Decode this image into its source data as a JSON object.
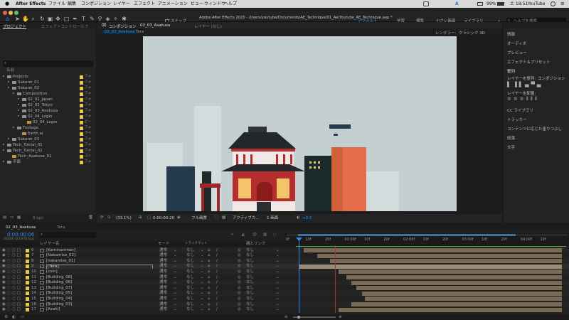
{
  "menubar": {
    "app": "After Effects",
    "items": [
      "ファイル",
      "編集",
      "コンポジション",
      "レイヤー",
      "エフェクト",
      "アニメーション",
      "ビュー",
      "ウィンドウ",
      "ヘルプ"
    ],
    "title": "Adobe After Effects 2020 - /Users/youtube/Documents/AE_Technique/01_Ae/Youtube_AE_Technique.aep *",
    "battery": "99%",
    "time": "土 18:51",
    "user": "YouTube",
    "input": "A"
  },
  "toolbar": {
    "snap_label": "スナップ",
    "workspaces": [
      "デフォルト",
      "学習",
      "標準",
      "小さい画面",
      "ライブラリ"
    ],
    "search_placeholder": "ヘルプを検索"
  },
  "project": {
    "tab": "プロジェクト",
    "tab2": "エフェクトコントロール T",
    "col_name": "名前",
    "items": [
      {
        "name": "Projects",
        "type": "フォ",
        "indent": 0,
        "folder": true
      },
      {
        "name": "Sakurei_01",
        "type": "フォ",
        "indent": 1,
        "folder": true
      },
      {
        "name": "Sakurei_02",
        "type": "フォ",
        "indent": 1,
        "folder": true
      },
      {
        "name": "Composition",
        "type": "フォ",
        "indent": 2,
        "folder": true
      },
      {
        "name": "02_01_Japan",
        "type": "フォ",
        "indent": 3,
        "folder": true
      },
      {
        "name": "02_02_Tokyo",
        "type": "フォ",
        "indent": 3,
        "folder": true
      },
      {
        "name": "02_03_Asakusa",
        "type": "フォ",
        "indent": 3,
        "folder": true
      },
      {
        "name": "02_04_Login",
        "type": "フォ",
        "indent": 3,
        "folder": true
      },
      {
        "name": "02_04_Login",
        "type": "ビー",
        "indent": 4,
        "folder": false
      },
      {
        "name": "Footage",
        "type": "フォ",
        "indent": 2,
        "folder": true
      },
      {
        "name": "Earth.ai",
        "type": "ラベ",
        "indent": 3,
        "folder": false
      },
      {
        "name": "Sakurei_03",
        "type": "フォ",
        "indent": 1,
        "folder": true
      },
      {
        "name": "Tech_Tutrial_01",
        "type": "フォ",
        "indent": 0,
        "folder": true
      },
      {
        "name": "Tech_Tutrial_02",
        "type": "フォ",
        "indent": 0,
        "folder": true
      },
      {
        "name": "Tech_Asakusa_01",
        "type": "コン",
        "indent": 1,
        "folder": false
      },
      {
        "name": "平面",
        "type": "フォ",
        "indent": 0,
        "folder": true
      }
    ],
    "bpc": "8 bpc"
  },
  "composition": {
    "panel_tab": "コンポジション",
    "comp_name": "02_03_Asakusa",
    "layer_tab": "レイヤー (なし)",
    "breadcrumb": [
      "02_03_Asakusa",
      "Tera"
    ],
    "renderer": "レンダラー:",
    "renderer_value": "クラシック 3D",
    "zoom": "(33.1%)",
    "timecode": "0:00:00:20",
    "resolution": "フル画質",
    "camera": "アクティブカ...",
    "views": "1 画面",
    "exposure": "+0.0"
  },
  "right": {
    "items": [
      "情報",
      "オーディオ",
      "プレビュー",
      "エフェクト＆プリセット",
      "整列",
      "レイヤーを整列:",
      "CC ライブラリ",
      "トラッカー",
      "コンテンツに応じた塗りつぶし",
      "段落",
      "文字"
    ],
    "align_target": "コンポジション",
    "distribute": "レイヤーを配置:"
  },
  "timeline": {
    "tabs": [
      "02_03_Asakusa",
      "Tera"
    ],
    "timecode": "0:00:00:06",
    "fps": "00006 (23.976 fps)",
    "col_layer": "レイヤー名",
    "col_mode": "モード",
    "col_trkmat": "トラックマット",
    "col_parent": "親とリンク",
    "ruler": [
      "0f",
      "10f",
      "20f",
      "01:00f",
      "10f",
      "20f",
      "02:00f",
      "10f",
      "20f",
      "03:00f",
      "10f",
      "20f",
      "04:00f",
      "10f"
    ],
    "layers": [
      {
        "num": "6",
        "name": "[Kaminarimon]",
        "mode": "通常",
        "tm": "なし",
        "parent": "なし",
        "start": 0.02,
        "end": 1.0,
        "sel": false
      },
      {
        "num": "7",
        "name": "[Nakamise_02]",
        "mode": "通常",
        "tm": "なし",
        "parent": "なし",
        "start": 0.07,
        "end": 1.0,
        "sel": false
      },
      {
        "num": "8",
        "name": "[nakamise_01]",
        "mode": "通常",
        "tm": "なし",
        "parent": "なし",
        "start": 0.12,
        "end": 1.0,
        "sel": false
      },
      {
        "num": "9",
        "name": "[Tera]",
        "mode": "通常",
        "tm": "なし",
        "parent": "なし",
        "start": 0.0,
        "end": 1.0,
        "sel": true
      },
      {
        "num": "10",
        "name": "[coin]",
        "mode": "通常",
        "tm": "なし",
        "parent": "なし",
        "start": 0.15,
        "end": 1.0,
        "sel": false
      },
      {
        "num": "11",
        "name": "[Building_08]",
        "mode": "通常",
        "tm": "なし",
        "parent": "なし",
        "start": 0.18,
        "end": 1.0,
        "sel": false
      },
      {
        "num": "12",
        "name": "[Building_06]",
        "mode": "通常",
        "tm": "なし",
        "parent": "なし",
        "start": 0.2,
        "end": 1.0,
        "sel": false
      },
      {
        "num": "13",
        "name": "[Building_07]",
        "mode": "通常",
        "tm": "なし",
        "parent": "なし",
        "start": 0.22,
        "end": 1.0,
        "sel": false
      },
      {
        "num": "14",
        "name": "[Building_05]",
        "mode": "通常",
        "tm": "なし",
        "parent": "なし",
        "start": 0.24,
        "end": 1.0,
        "sel": false
      },
      {
        "num": "15",
        "name": "[Building_04]",
        "mode": "通常",
        "tm": "なし",
        "parent": "なし",
        "start": 0.25,
        "end": 1.0,
        "sel": false
      },
      {
        "num": "16",
        "name": "[Building_03]",
        "mode": "通常",
        "tm": "なし",
        "parent": "なし",
        "start": 0.2,
        "end": 1.0,
        "sel": false
      },
      {
        "num": "17",
        "name": "[Asahi]",
        "mode": "通常",
        "tm": "なし",
        "parent": "なし",
        "start": 0.15,
        "end": 1.0,
        "sel": false
      }
    ]
  },
  "colors": {
    "accent": "#2d8ceb",
    "label": "#e8c84a",
    "playhead": "#2d8ceb",
    "comp_bg": "#c3cfd0",
    "bar": "#7a6a55",
    "bar_selected": "#9a8b76"
  }
}
